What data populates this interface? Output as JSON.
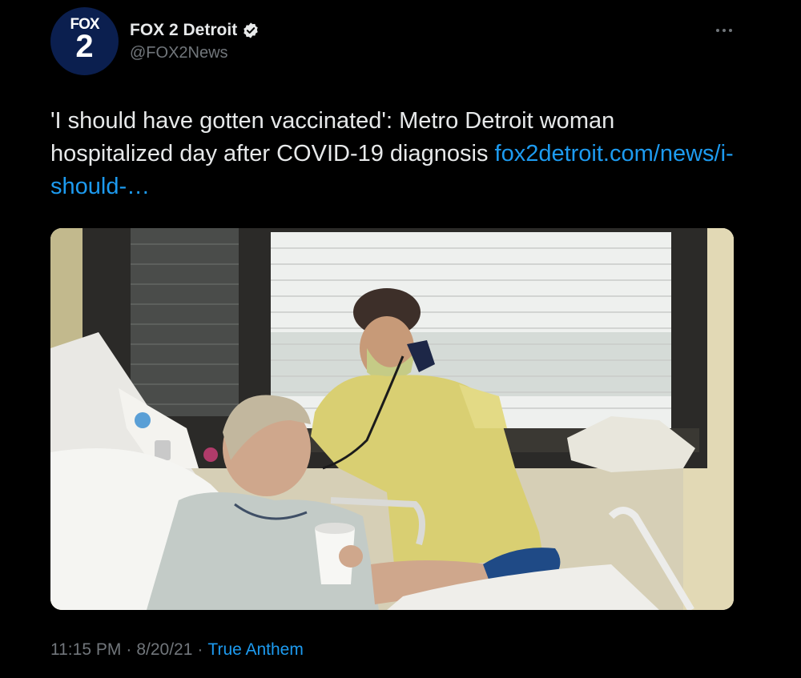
{
  "author": {
    "avatar_text_top": "FOX",
    "avatar_text_bottom": "2",
    "display_name": "FOX 2 Detroit",
    "handle": "@FOX2News",
    "verified": true
  },
  "tweet": {
    "text": "'I should have gotten vaccinated': Metro Detroit woman hospitalized day after COVID-19 diagnosis ",
    "link_text": "fox2detroit.com/news/i-should-…"
  },
  "meta": {
    "time": "11:15 PM",
    "separator": "·",
    "date": "8/20/21",
    "source": "True Anthem"
  },
  "icons": {
    "more": "more-dots-icon",
    "verified": "verified-badge-icon"
  },
  "colors": {
    "background": "#000000",
    "text": "#e7e9ea",
    "secondary": "#71767b",
    "link": "#1d9bf0",
    "avatar": "#0b1f4f"
  }
}
